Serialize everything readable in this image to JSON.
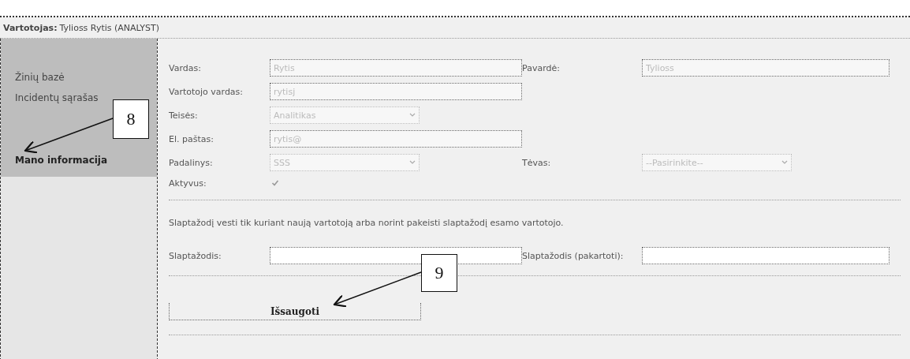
{
  "header": {
    "label": "Vartotojas:",
    "value": "Tylioss Rytis (ANALYST)"
  },
  "sidebar": {
    "items": [
      {
        "label": "Žinių bazė",
        "selected": false
      },
      {
        "label": "Incidentų sąrašas",
        "selected": false
      },
      {
        "label": "Mano informacija",
        "selected": true
      }
    ]
  },
  "form": {
    "rows": [
      {
        "label": "Vardas:",
        "value": "Rytis",
        "kind": "text",
        "disabled": true
      },
      {
        "label": "Pavardė:",
        "value": "Tylioss",
        "kind": "text",
        "disabled": true
      },
      {
        "label": "Vartotojo vardas:",
        "value": "rytisj",
        "kind": "text",
        "disabled": true
      },
      {
        "label": "Teisės:",
        "value": "Analitikas",
        "kind": "select",
        "disabled": true
      },
      {
        "label": "El. paštas:",
        "value": "rytis@",
        "kind": "text",
        "disabled": true
      },
      {
        "label": "Padalinys:",
        "value": "SSS",
        "kind": "select",
        "disabled": true
      },
      {
        "label": "Tėvas:",
        "value": "--Pasirinkite--",
        "kind": "select",
        "disabled": true
      },
      {
        "label": "Aktyvus:",
        "kind": "checkbox",
        "checked": true,
        "disabled": true
      }
    ],
    "note": "Slaptažodį vesti tik kuriant naują vartotoją arba norint pakeisti slaptažodį esamo vartotojo.",
    "passwords": [
      {
        "label": "Slaptažodis:"
      },
      {
        "label": "Slaptažodis (pakartoti):"
      }
    ],
    "save_button": "Išsaugoti"
  },
  "annotations": [
    {
      "label": "8"
    },
    {
      "label": "9"
    }
  ]
}
